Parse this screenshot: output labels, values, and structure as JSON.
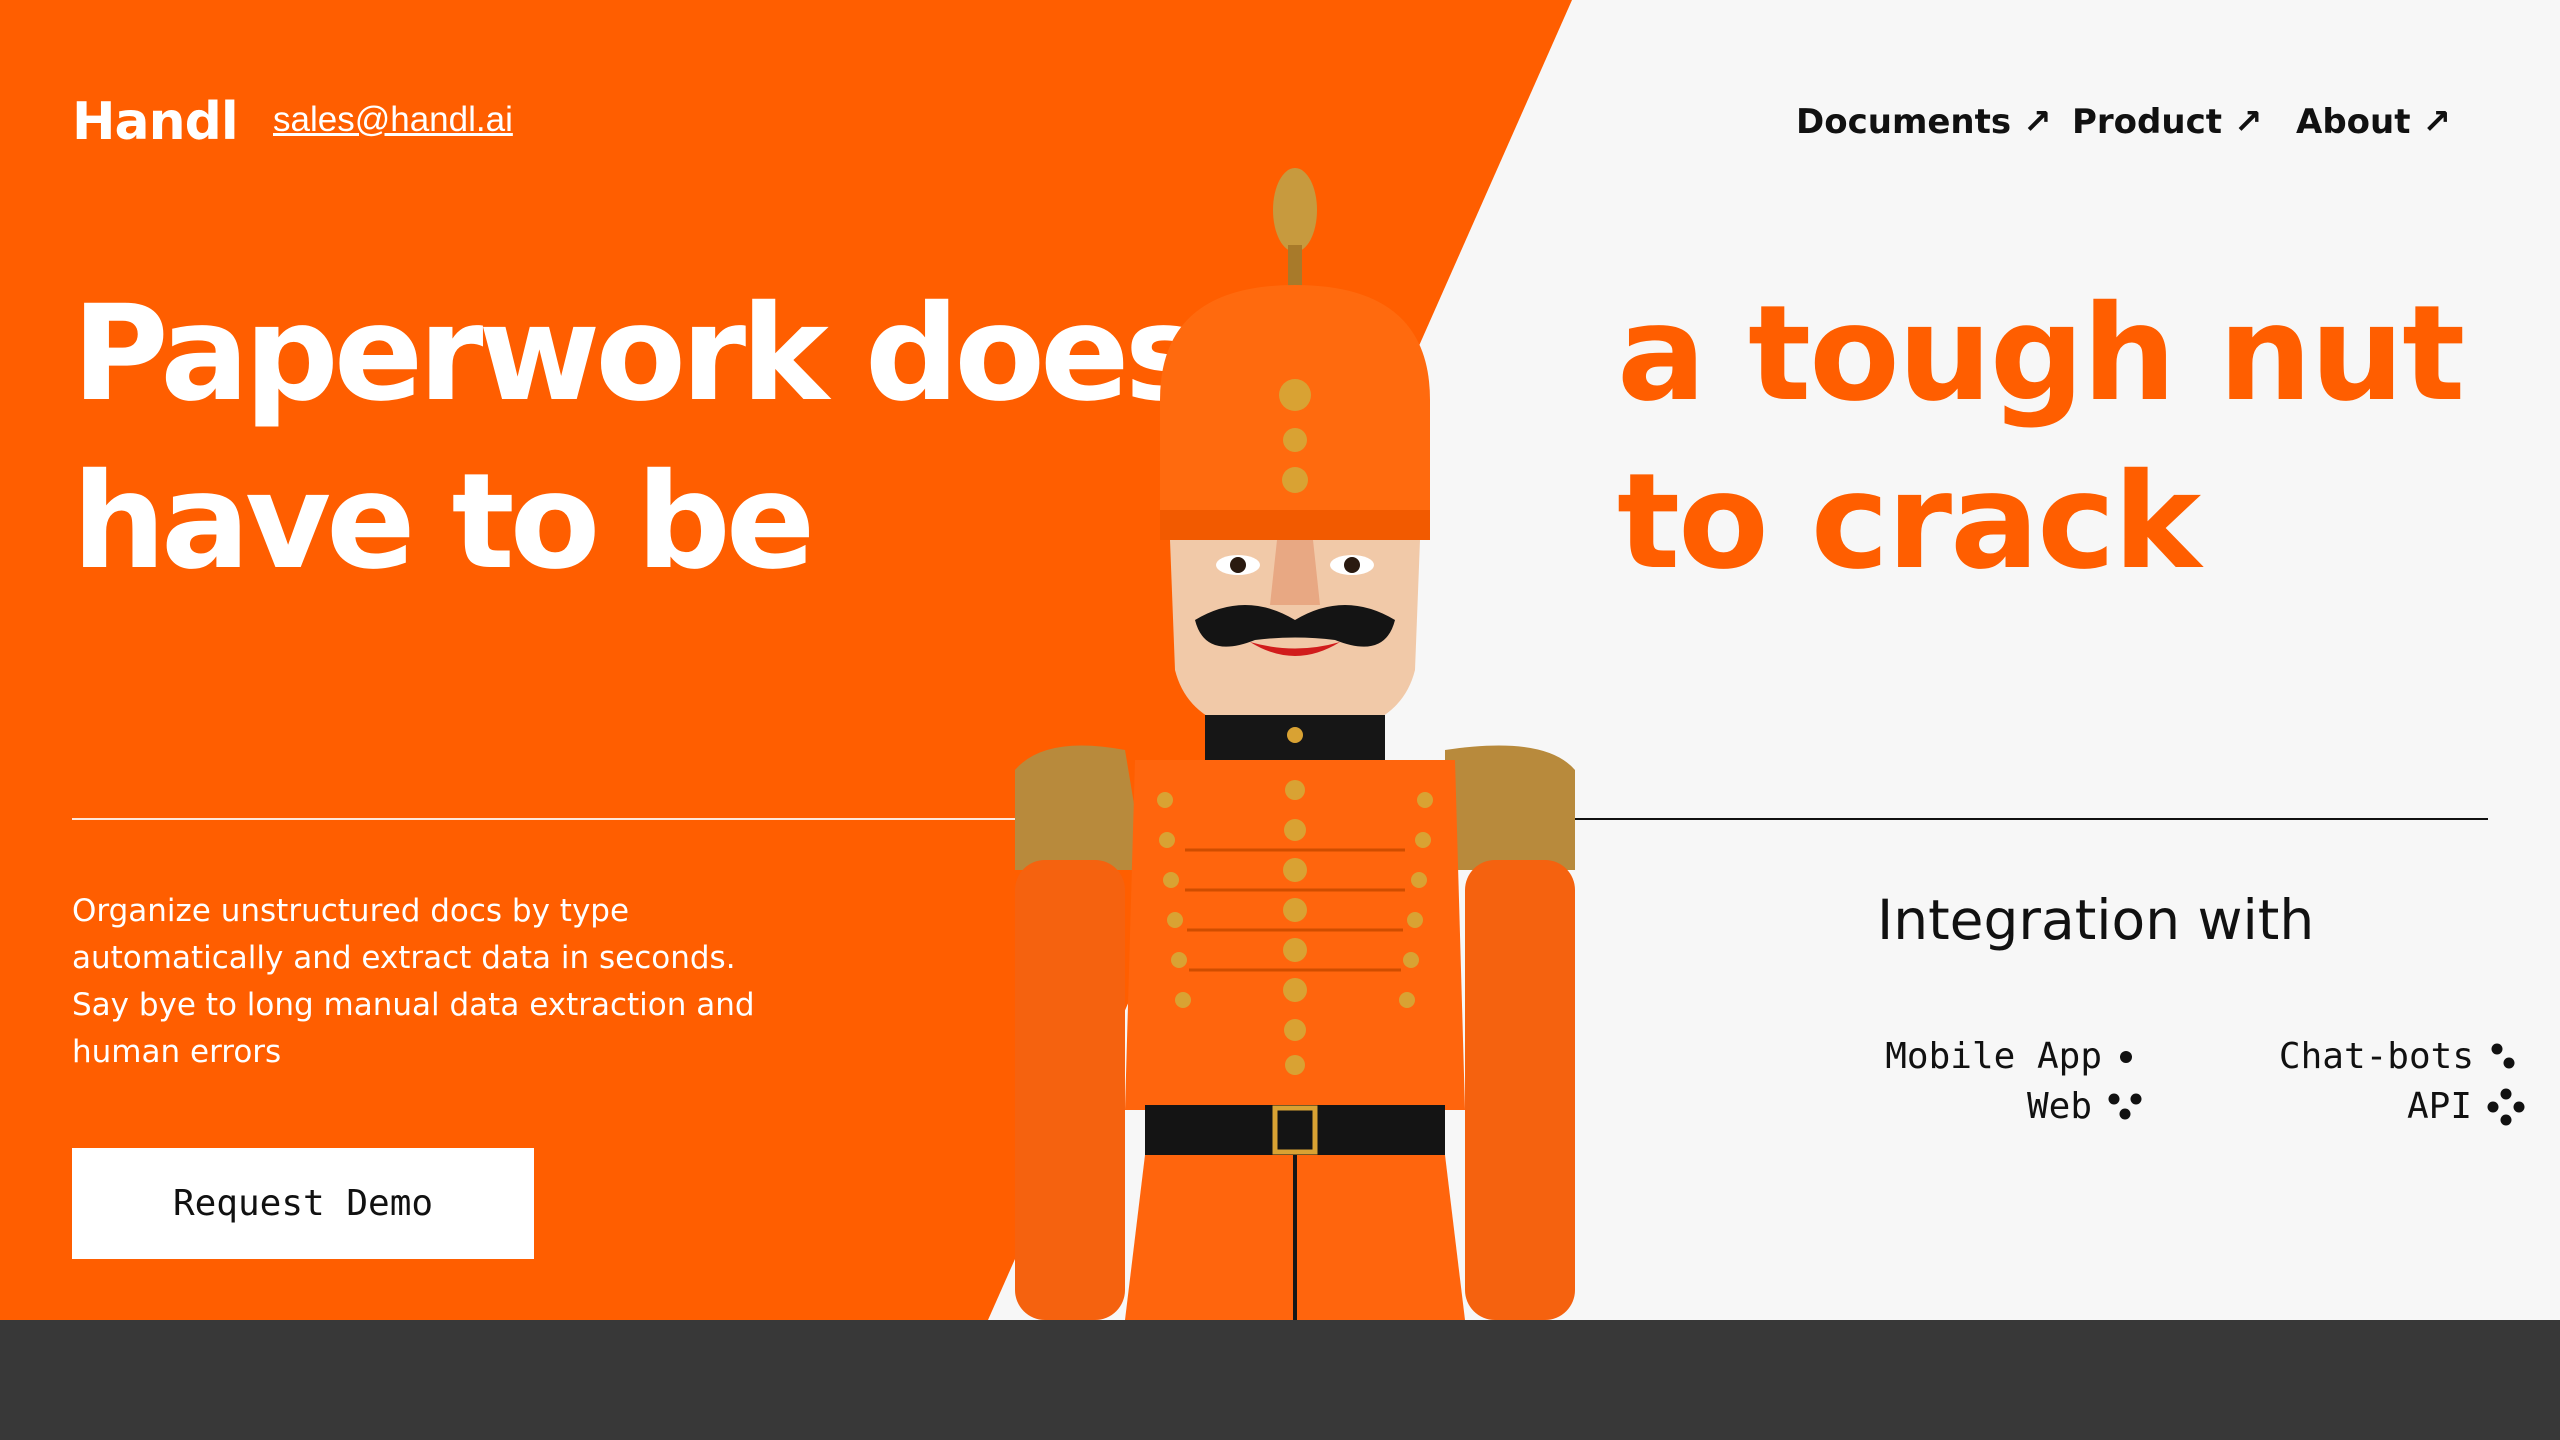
{
  "brand": {
    "logo": "Handl",
    "email": "sales@handl.ai"
  },
  "nav": [
    {
      "label": "Documents",
      "icon": "arrow-up-right-icon"
    },
    {
      "label": "Product",
      "icon": "arrow-up-right-icon"
    },
    {
      "label": "About",
      "icon": "arrow-up-right-icon"
    }
  ],
  "hero": {
    "line1": "Paperwork doesn’t",
    "line2": "have to be",
    "line3": "a tough nut",
    "line4": "to crack",
    "description": "Organize unstructured docs by type automatically and extract data in seconds. Say bye to long manual data extraction and human errors",
    "cta": "Request Demo",
    "image": "nutcracker-soldier-figure"
  },
  "integration": {
    "title": "Integration with",
    "items": [
      {
        "label": "Mobile App",
        "icon": "one-dot-icon"
      },
      {
        "label": "Web",
        "icon": "three-dots-icon"
      },
      {
        "label": "Chat-bots",
        "icon": "two-dots-icon"
      },
      {
        "label": "API",
        "icon": "four-dots-icon"
      }
    ]
  },
  "colors": {
    "accent": "#ff5e00",
    "background": "#f7f7f7",
    "footer": "#383838",
    "text": "#111111"
  }
}
